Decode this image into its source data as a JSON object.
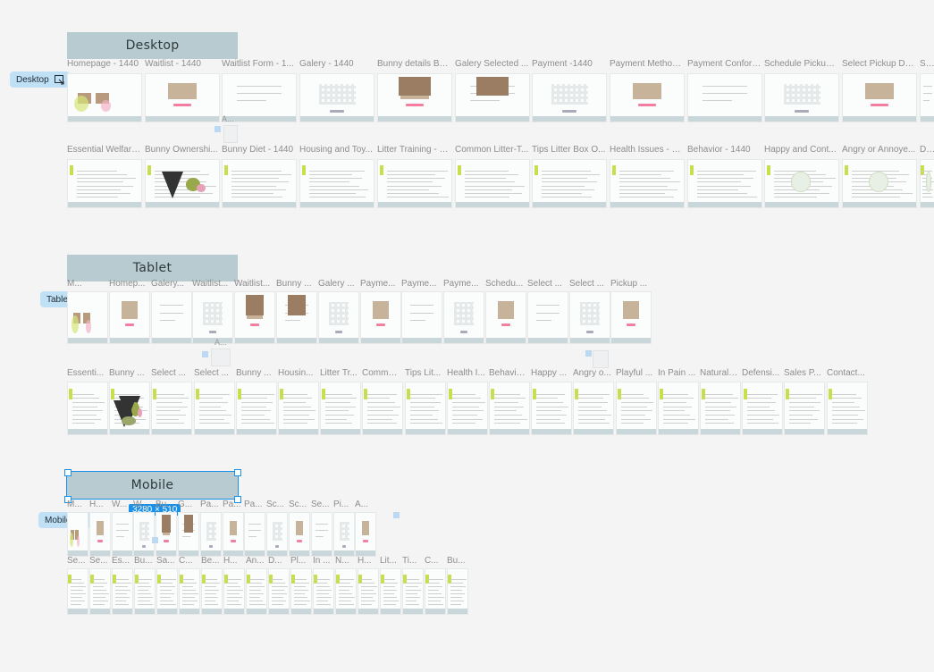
{
  "sections": {
    "desktop": {
      "title": "Desktop",
      "chip": "Desktop",
      "row1": [
        "Homepage - 1440",
        "Waitlist - 1440",
        "Waitlist Form - 1...",
        "Galery - 1440",
        "Bunny details Bel...",
        "Galery Selected ...",
        "Payment -1440",
        "Payment Method...",
        "Payment Conforr...",
        "Schedule Pickup ...",
        "Select Pickup Da...",
        "Selec"
      ],
      "row2": [
        "Essential Welfare...",
        "Bunny Ownershi...",
        "Bunny Diet - 1440",
        "Housing and Toy...",
        "Litter Training - 1...",
        "Common Litter-T...",
        "Tips Litter Box O...",
        "Health Issues - 1...",
        "Behavior - 1440",
        "Happy and Cont...",
        "Angry or Annoye...",
        "Defe"
      ]
    },
    "tablet": {
      "title": "Tablet",
      "chip": "Tablet",
      "row1": [
        "M...",
        "Homep...",
        "Galery...",
        "Waitlist...",
        "Waitlist...",
        "Bunny ...",
        "Galery ...",
        "Payme...",
        "Payme...",
        "Payme...",
        "Schedu...",
        "Select ...",
        "Select ...",
        "Pickup ..."
      ],
      "row2": [
        "Essenti...",
        "Bunny ...",
        "Select ...",
        "Select ...",
        "Bunny ...",
        "Housin...",
        "Litter Tr...",
        "Commo...",
        "Tips Lit...",
        "Health I...",
        "Behavio...",
        "Happy ...",
        "Angry o...",
        "Playful ...",
        "In Pain ...",
        "Natural ...",
        "Defensi...",
        "Sales P...",
        "Contact..."
      ]
    },
    "mobile": {
      "title": "Mobile",
      "chip": "Mobile",
      "size_badge": "3280 × 510",
      "row1": [
        "M...",
        "H...",
        "W...",
        "W...",
        "Bu...",
        "G...",
        "Pa...",
        "Pa...",
        "Pa...",
        "Sc...",
        "Sc...",
        "Se...",
        "Pi...",
        "A..."
      ],
      "row2": [
        "Se...",
        "Se...",
        "Es...",
        "Bu...",
        "Sa...",
        "C...",
        "Be...",
        "H...",
        "An...",
        "D...",
        "Pl...",
        "In ...",
        "N...",
        "H...",
        "Lit...",
        "Ti...",
        "C...",
        "Bu..."
      ]
    }
  },
  "stray_label": "A...",
  "colors": {
    "banner": "#b8cbd1",
    "chip": "#bfe0f5",
    "selection": "#1a90e8",
    "accent_pink": "#f27fa0"
  }
}
